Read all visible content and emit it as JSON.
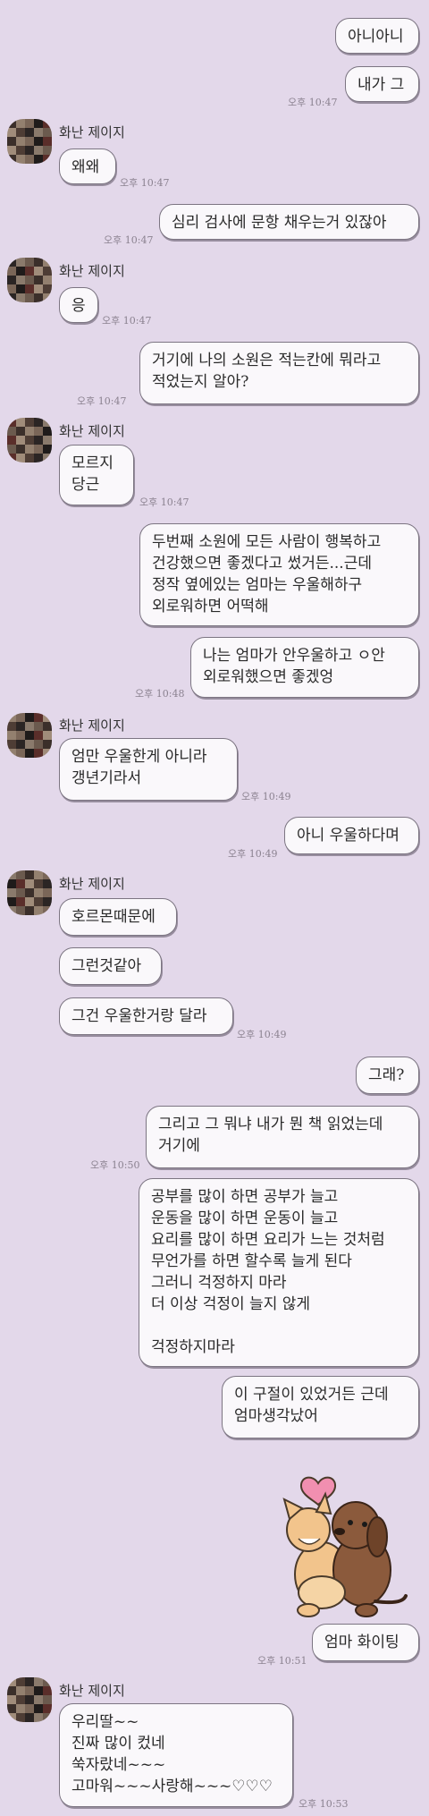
{
  "sender_name": "화난 제이지",
  "messages": [
    {
      "text": "아니아니"
    },
    {
      "text": "내가 그",
      "time": "오후 10:47"
    },
    {
      "text": "왜왜",
      "time": "오후 10:47"
    },
    {
      "text": "심리 검사에 문항 채우는거 있잖아",
      "time": "오후 10:47"
    },
    {
      "text": "응",
      "time": "오후 10:47"
    },
    {
      "text": "거기에 나의 소원은 적는칸에 뭐라고\n적었는지 알아?",
      "time": "오후 10:47"
    },
    {
      "text": "모르지\n당근",
      "time": "오후 10:47"
    },
    {
      "text": "두번째 소원에 모든 사람이 행복하고\n건강했으면 좋겠다고 썼거든...근데\n정작 옆에있는 엄마는 우울해하구\n외로워하면 어떡해"
    },
    {
      "text": "나는 엄마가 안우울하고 ㅇ안\n외로워했으면 좋겠엉",
      "time": "오후 10:48"
    },
    {
      "text": "엄만 우울한게 아니라\n갱년기라서",
      "time": "오후 10:49"
    },
    {
      "text": "아니 우울하다며",
      "time": "오후 10:49"
    },
    {
      "text": "호르몬때문에"
    },
    {
      "text": "그런것같아"
    },
    {
      "text": "그건 우울한거랑 달라",
      "time": "오후 10:49"
    },
    {
      "text": "그래?"
    },
    {
      "text": "그리고 그 뭐냐 내가 뭔 책 읽었는데\n거기에",
      "time": "오후 10:50"
    },
    {
      "text": "공부를 많이 하면 공부가 늘고\n운동을 많이 하면 운동이 늘고\n요리를 많이 하면 요리가 느는 것처럼\n무언가를 하면 할수록 늘게 된다\n그러니 걱정하지 마라\n더 이상 걱정이 늘지 않게\n\n걱정하지마라"
    },
    {
      "text": "이 구절이 있었거든 근데\n엄마생각났어"
    },
    {
      "text": "엄마 화이팅",
      "time": "오후 10:51"
    },
    {
      "text": "우리딸~~\n진짜 많이 컸네\n쑥자랐네~~~\n고마워~~~사랑해~~~♡♡♡",
      "time": "오후 10:53"
    }
  ],
  "sticker": {
    "icon": "dogs-hugging-heart-sticker"
  },
  "colors": {
    "background": "#e3d8ea",
    "bubble": "#faf8fb",
    "border": "#7c7582",
    "heart": "#f18fb0"
  }
}
